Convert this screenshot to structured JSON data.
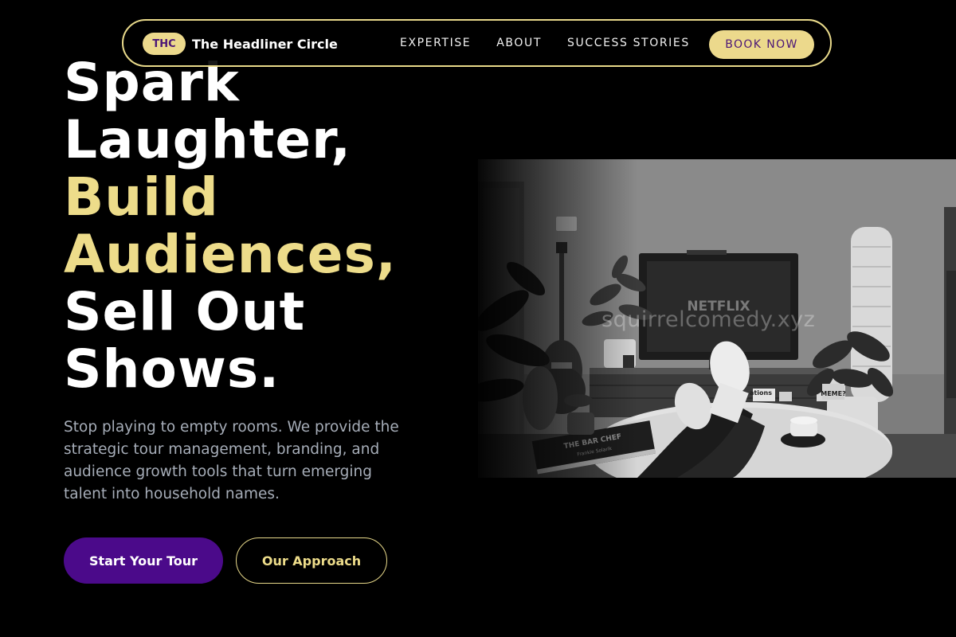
{
  "brand": {
    "badge": "THC",
    "name": "The Headliner Circle"
  },
  "nav": {
    "links": [
      {
        "label": "EXPERTISE"
      },
      {
        "label": "ABOUT"
      },
      {
        "label": "SUCCESS STORIES"
      }
    ],
    "cta_label": "BOOK NOW"
  },
  "hero": {
    "headline_lines": [
      "Spark",
      "Laughter,",
      "Build",
      "Audiences,",
      "Sell Out",
      "Shows."
    ],
    "subtext": "Stop playing to empty rooms. We provide the strategic tour management, branding, and audience growth tools that turn emerging talent into household names.",
    "primary_cta": "Start Your Tour",
    "secondary_cta": "Our Approach",
    "image": {
      "watermark": "squirrelcomedy.xyz",
      "tv_brand": "NETFLIX",
      "book_title": "THE BAR CHEF",
      "book_subtitle": "Frankie Solarik",
      "meme_label": "MEME?",
      "magazine_label": "ations"
    }
  },
  "colors": {
    "background": "#000000",
    "accent_gold": "#eddc8a",
    "accent_purple": "#4b0a8a",
    "badge_text": "#4b1677",
    "subtext": "#a6adb8"
  }
}
